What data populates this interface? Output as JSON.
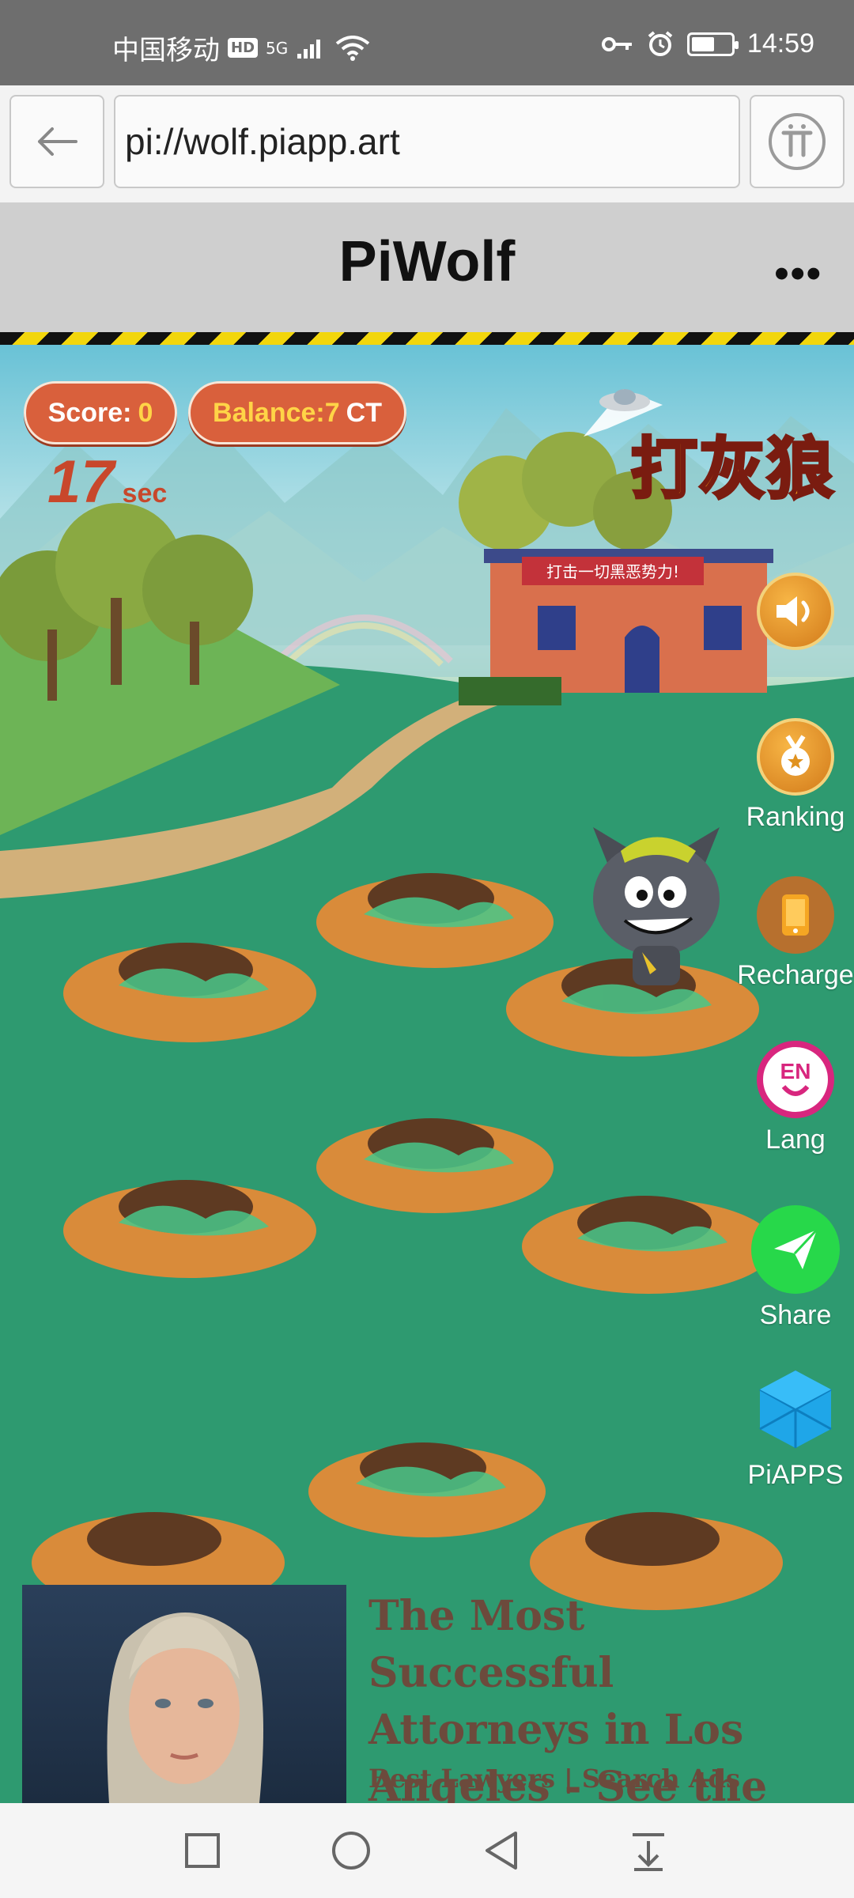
{
  "status_bar": {
    "carrier": "中国移动",
    "hd": "HD",
    "network": "5G",
    "time": "14:59"
  },
  "browser": {
    "url": "pi://wolf.piapp.art"
  },
  "app": {
    "title": "PiWolf",
    "more": "•••"
  },
  "game": {
    "score_label": "Score:",
    "score_value": "0",
    "balance_label": "Balance:7",
    "balance_unit": "CT",
    "timer_value": "17",
    "timer_unit": "sec",
    "logo_text": "打灰狼",
    "house_banner": "打击一切黑恶势力!"
  },
  "side_menu": [
    {
      "label": "",
      "icon": "sound-icon"
    },
    {
      "label": "Ranking",
      "icon": "medal-icon"
    },
    {
      "label": "Recharge",
      "icon": "phone-icon"
    },
    {
      "label": "Lang",
      "icon": "language-icon"
    },
    {
      "label": "Share",
      "icon": "paper-plane-icon"
    },
    {
      "label": "PiAPPS",
      "icon": "cubes-icon"
    }
  ],
  "ad": {
    "title": "The Most Successful Attorneys in Los Angeles - See the List",
    "source": "Best Lawyers | Search Ads"
  },
  "colors": {
    "pill": "#d9603c",
    "accent_yellow": "#ffd447",
    "share_green": "#27d84a",
    "lang_pink": "#d8267e"
  }
}
